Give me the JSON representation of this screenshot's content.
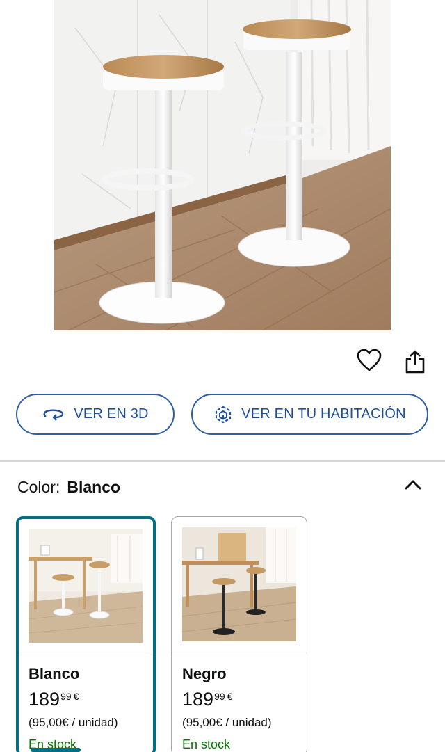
{
  "product": {
    "image_alt": "Two white adjustable bar stools with wooden seats"
  },
  "actions": {
    "favorite_icon": "heart-icon",
    "share_icon": "share-icon"
  },
  "buttons": {
    "view_3d": "VER EN 3D",
    "view_room": "VER EN TU HABITACIÓN"
  },
  "colors": {
    "accent": "#007185",
    "button_blue": "#2f5ea8",
    "in_stock": "#007600"
  },
  "color_section": {
    "label": "Color:",
    "selected": "Blanco",
    "options": [
      {
        "name": "Blanco",
        "price_int": "189",
        "price_dec": "99",
        "currency": "€",
        "unit_price": "(95,00€ / unidad)",
        "availability": "En stock"
      },
      {
        "name": "Negro",
        "price_int": "189",
        "price_dec": "99",
        "currency": "€",
        "unit_price": "(95,00€ / unidad)",
        "availability": "En stock"
      }
    ]
  }
}
